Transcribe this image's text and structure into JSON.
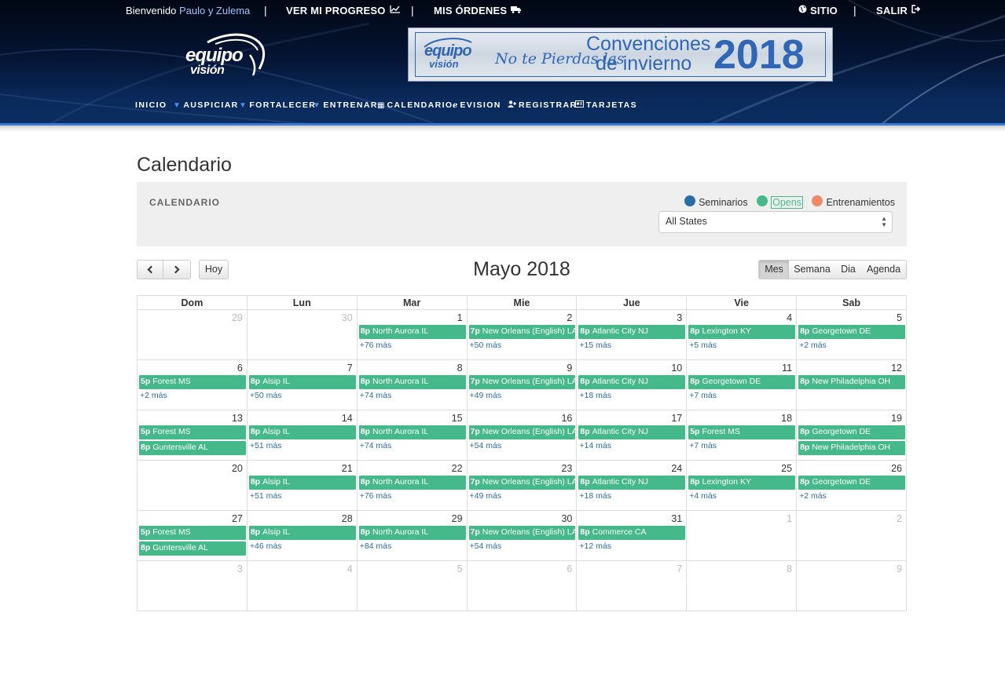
{
  "topbar": {
    "welcome": "Bienvenido",
    "user": "Paulo y Zulema",
    "progress": "VER MI PROGRESO",
    "orders": "MIS ÓRDENES",
    "site": "SITIO",
    "logout": "SALIR"
  },
  "logo": {
    "line1": "equipo",
    "line2": "visión"
  },
  "banner": {
    "logo1": "equipo",
    "logo2": "visión",
    "slogan": "No te Pierdas las",
    "line1": "Convenciones",
    "line2": "de invierno",
    "year": "2018"
  },
  "nav": {
    "inicio": "INICIO",
    "auspiciar": "AUSPICIAR",
    "fortalecer": "FORTALECER",
    "entrenar": "ENTRENAR",
    "calendario": "CALENDARIO",
    "evision": "EVISION",
    "registrar": "REGISTRAR",
    "tarjetas": "TARJETAS"
  },
  "page_title": "Calendario",
  "filter": {
    "label": "CALENDARIO",
    "legend": [
      {
        "label": "Seminarios",
        "color": "#2a6ea7"
      },
      {
        "label": "Opens",
        "color": "#46b98a"
      },
      {
        "label": "Entrenamientos",
        "color": "#f08a67"
      }
    ],
    "state_select": "All States"
  },
  "toolbar": {
    "today": "Hoy",
    "title": "Mayo 2018",
    "views": [
      "Mes",
      "Semana",
      "Dia",
      "Agenda"
    ],
    "active_view": "Mes"
  },
  "calendar": {
    "weekdays": [
      "Dom",
      "Lun",
      "Mar",
      "Mie",
      "Jue",
      "Vie",
      "Sab"
    ],
    "weeks": [
      [
        {
          "day": "29",
          "other": true,
          "events": [],
          "more": ""
        },
        {
          "day": "30",
          "other": true,
          "events": [],
          "more": ""
        },
        {
          "day": "1",
          "events": [
            {
              "time": "8p",
              "title": "North Aurora IL"
            }
          ],
          "more": "+76 más"
        },
        {
          "day": "2",
          "events": [
            {
              "time": "7p",
              "title": "New Orleans (English) LA"
            }
          ],
          "more": "+50 más"
        },
        {
          "day": "3",
          "events": [
            {
              "time": "8p",
              "title": "Atlantic City NJ"
            }
          ],
          "more": "+15 más"
        },
        {
          "day": "4",
          "events": [
            {
              "time": "8p",
              "title": "Lexington KY"
            }
          ],
          "more": "+5 más"
        },
        {
          "day": "5",
          "events": [
            {
              "time": "8p",
              "title": "Georgetown DE"
            }
          ],
          "more": "+2 más"
        }
      ],
      [
        {
          "day": "6",
          "events": [
            {
              "time": "5p",
              "title": "Forest MS"
            }
          ],
          "more": "+2 más"
        },
        {
          "day": "7",
          "events": [
            {
              "time": "8p",
              "title": "Alsip IL"
            }
          ],
          "more": "+50 más"
        },
        {
          "day": "8",
          "events": [
            {
              "time": "8p",
              "title": "North Aurora IL"
            }
          ],
          "more": "+74 más"
        },
        {
          "day": "9",
          "events": [
            {
              "time": "7p",
              "title": "New Orleans (English) LA"
            }
          ],
          "more": "+49 más"
        },
        {
          "day": "10",
          "events": [
            {
              "time": "8p",
              "title": "Atlantic City NJ"
            }
          ],
          "more": "+18 más"
        },
        {
          "day": "11",
          "events": [
            {
              "time": "8p",
              "title": "Georgetown DE"
            }
          ],
          "more": "+7 más"
        },
        {
          "day": "12",
          "events": [
            {
              "time": "8p",
              "title": "New Philadelphia OH"
            }
          ],
          "more": ""
        }
      ],
      [
        {
          "day": "13",
          "events": [
            {
              "time": "5p",
              "title": "Forest MS"
            },
            {
              "time": "8p",
              "title": "Guntersville AL"
            }
          ],
          "more": ""
        },
        {
          "day": "14",
          "events": [
            {
              "time": "8p",
              "title": "Alsip IL"
            }
          ],
          "more": "+51 más"
        },
        {
          "day": "15",
          "events": [
            {
              "time": "8p",
              "title": "North Aurora IL"
            }
          ],
          "more": "+74 más"
        },
        {
          "day": "16",
          "events": [
            {
              "time": "7p",
              "title": "New Orleans (English) LA"
            }
          ],
          "more": "+54 más"
        },
        {
          "day": "17",
          "events": [
            {
              "time": "8p",
              "title": "Atlantic City NJ"
            }
          ],
          "more": "+14 más"
        },
        {
          "day": "18",
          "events": [
            {
              "time": "5p",
              "title": "Forest MS"
            }
          ],
          "more": "+7 más"
        },
        {
          "day": "19",
          "events": [
            {
              "time": "8p",
              "title": "Georgetown DE"
            },
            {
              "time": "8p",
              "title": "New Philadelphia OH"
            }
          ],
          "more": ""
        }
      ],
      [
        {
          "day": "20",
          "events": [],
          "more": ""
        },
        {
          "day": "21",
          "events": [
            {
              "time": "8p",
              "title": "Alsip IL"
            }
          ],
          "more": "+51 más"
        },
        {
          "day": "22",
          "events": [
            {
              "time": "8p",
              "title": "North Aurora IL"
            }
          ],
          "more": "+76 más"
        },
        {
          "day": "23",
          "events": [
            {
              "time": "7p",
              "title": "New Orleans (English) LA"
            }
          ],
          "more": "+49 más"
        },
        {
          "day": "24",
          "events": [
            {
              "time": "8p",
              "title": "Atlantic City NJ"
            }
          ],
          "more": "+18 más"
        },
        {
          "day": "25",
          "events": [
            {
              "time": "8p",
              "title": "Lexington KY"
            }
          ],
          "more": "+4 más"
        },
        {
          "day": "26",
          "events": [
            {
              "time": "8p",
              "title": "Georgetown DE"
            }
          ],
          "more": "+2 más"
        }
      ],
      [
        {
          "day": "27",
          "events": [
            {
              "time": "5p",
              "title": "Forest MS"
            },
            {
              "time": "8p",
              "title": "Guntersville AL"
            }
          ],
          "more": ""
        },
        {
          "day": "28",
          "events": [
            {
              "time": "8p",
              "title": "Alsip IL"
            }
          ],
          "more": "+46 más"
        },
        {
          "day": "29",
          "events": [
            {
              "time": "8p",
              "title": "North Aurora IL"
            }
          ],
          "more": "+84 más"
        },
        {
          "day": "30",
          "events": [
            {
              "time": "7p",
              "title": "New Orleans (English) LA"
            }
          ],
          "more": "+54 más"
        },
        {
          "day": "31",
          "events": [
            {
              "time": "8p",
              "title": "Commerce CA"
            }
          ],
          "more": "+12 más"
        },
        {
          "day": "1",
          "other": true,
          "events": [],
          "more": ""
        },
        {
          "day": "2",
          "other": true,
          "events": [],
          "more": ""
        }
      ],
      [
        {
          "day": "3",
          "other": true,
          "events": [],
          "more": ""
        },
        {
          "day": "4",
          "other": true,
          "events": [],
          "more": ""
        },
        {
          "day": "5",
          "other": true,
          "events": [],
          "more": ""
        },
        {
          "day": "6",
          "other": true,
          "events": [],
          "more": ""
        },
        {
          "day": "7",
          "other": true,
          "events": [],
          "more": ""
        },
        {
          "day": "8",
          "other": true,
          "events": [],
          "more": ""
        },
        {
          "day": "9",
          "other": true,
          "events": [],
          "more": ""
        }
      ]
    ]
  }
}
